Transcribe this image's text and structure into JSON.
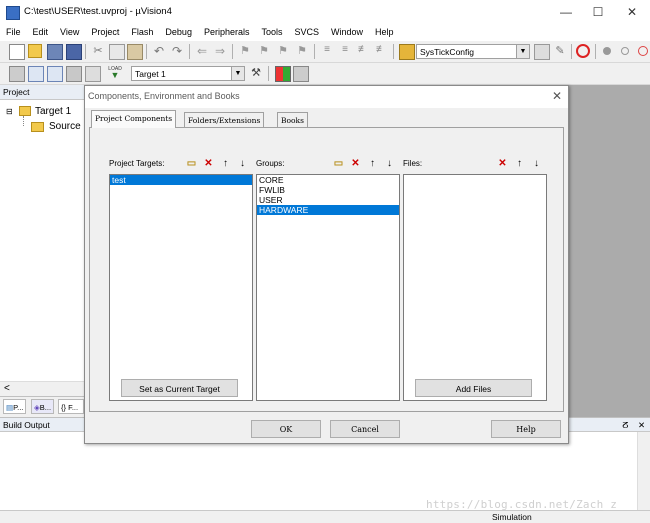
{
  "window": {
    "title": "C:\\test\\USER\\test.uvproj - µVision4",
    "minimize": "—",
    "maximize": "☐",
    "close": "✕"
  },
  "menu": [
    "File",
    "Edit",
    "View",
    "Project",
    "Flash",
    "Debug",
    "Peripherals",
    "Tools",
    "SVCS",
    "Window",
    "Help"
  ],
  "toolbar": {
    "function_combo": "SysTickConfig",
    "target_combo": "Target 1"
  },
  "project_panel": {
    "header": "Project",
    "tree": [
      {
        "label": "Target 1",
        "expander": "⊟"
      },
      {
        "label": "Source"
      }
    ],
    "scroll_left": "<",
    "tabs": [
      "P...",
      "B...",
      "{} F..."
    ]
  },
  "build_output": {
    "header": "Build Output",
    "pin": "ⵒ",
    "close": "✕"
  },
  "status": {
    "mode": "Simulation"
  },
  "dialog": {
    "title": "Components, Environment and Books",
    "close": "✕",
    "tabs": [
      "Project Components",
      "Folders/Extensions",
      "Books"
    ],
    "targets": {
      "label": "Project Targets:",
      "items": [
        {
          "name": "test",
          "selected": true
        }
      ]
    },
    "groups": {
      "label": "Groups:",
      "items": [
        {
          "name": "CORE",
          "selected": false
        },
        {
          "name": "FWLIB",
          "selected": false
        },
        {
          "name": "USER",
          "selected": false
        },
        {
          "name": "HARDWARE",
          "selected": true
        }
      ]
    },
    "files": {
      "label": "Files:",
      "items": []
    },
    "set_current_button": "Set as Current Target",
    "add_files_button": "Add Files",
    "ok_button": "OK",
    "cancel_button": "Cancel",
    "help_button": "Help"
  },
  "watermark": "https://blog.csdn.net/Zach_z",
  "colors": {
    "selection": "#0078d7",
    "delete_icon": "#cc0000"
  }
}
